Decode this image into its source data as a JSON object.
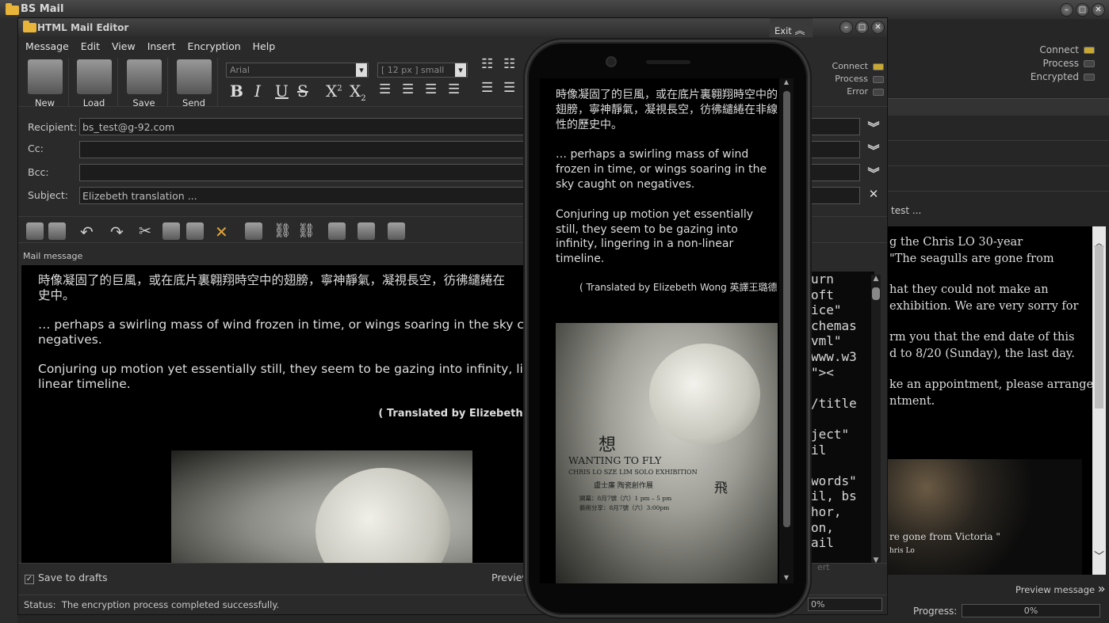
{
  "main": {
    "title": "BS Mail",
    "status": {
      "connect": "Connect",
      "process": "Process",
      "encrypted": "Encrypted"
    },
    "subject_fragment": "test ...",
    "message_lines": [
      "g the Chris LO 30-year",
      "\"The seagulls are gone from",
      "hat they could not make an",
      "exhibition. We are very sorry for",
      "rm you that the end date of this",
      "d to 8/20 (Sunday), the last day.",
      "ke an appointment, please arrange",
      "ntment."
    ],
    "photo_caption_1": "re gone from Victoria \"",
    "photo_caption_2": "hris Lo",
    "preview_message": "Preview message",
    "progress_label": "Progress:",
    "progress_value": "0%"
  },
  "editor": {
    "title": "HTML Mail Editor",
    "exit_label": "Exit",
    "menu": [
      "Message",
      "Edit",
      "View",
      "Insert",
      "Encryption",
      "Help"
    ],
    "toolbar": {
      "new": "New",
      "load": "Load",
      "save": "Save",
      "send": "Send"
    },
    "font_family": "Arial",
    "font_size": "[ 12 px ] small",
    "status_leds": {
      "connect": "Connect",
      "process": "Process",
      "error": "Error"
    },
    "fields": {
      "recipient_label": "Recipient:",
      "recipient_value": "bs_test@g-92.com",
      "cc_label": "Cc:",
      "bcc_label": "Bcc:",
      "subject_label": "Subject:",
      "subject_value": "Elizebeth translation ..."
    },
    "mail_message_label": "Mail message",
    "body": {
      "line1": "時像凝固了的巨風，或在底片裏翱翔時空中的翅膀，寧神靜氣，凝視長空，彷彿繾綣在",
      "line1b": "史中。",
      "line2": "… perhaps a swirling mass of wind frozen in time, or wings soaring in the sky caught",
      "line2b": "negatives.",
      "line3": "Conjuring up motion yet essentially still, they seem to be gazing into infinity, lingering",
      "line3b": "linear timeline.",
      "translated": "( Translated by Elizebeth Wo"
    },
    "code_lines": [
      "urn",
      "oft",
      "ice\"",
      "chemas",
      "vml\"",
      "www.w3",
      "\"><",
      "",
      "/title",
      "",
      "ject\"",
      "il",
      "",
      "words\"",
      "il, bs",
      "hor,",
      "on,",
      "ail"
    ],
    "save_to_drafts": "Save to drafts",
    "preview_label": "Preview",
    "insert_fragment": "ert",
    "status_label": "Status:",
    "status_text": "The encryption process completed successfully.",
    "progress_value": "0%"
  },
  "phone": {
    "para1": "時像凝固了的巨風，或在底片裏翱翔時空中的翅膀，寧神靜氣，凝視長空，彷彿繾綣在非線性的歷史中。",
    "para2": "… perhaps a swirling mass of wind frozen in time, or wings soaring in the sky caught on negatives.",
    "para3": "Conjuring up motion yet essentially still, they seem to be gazing into infinity, lingering in a non-linear timeline.",
    "translated": "( Translated by Elizebeth Wong 英譯王璐德 )",
    "poster": {
      "cn_char_1": "想",
      "title": "WANTING TO FLY",
      "subtitle": "CHRIS LO SZE LIM SOLO EXHIBITION",
      "cn_title": "盧士廉  陶瓷創作展",
      "cn_char_2": "飛",
      "date1": "開幕：8月7號（六）1 pm – 5 pm",
      "date2": "藝術分享：8月7號（六）3:00pm"
    }
  }
}
